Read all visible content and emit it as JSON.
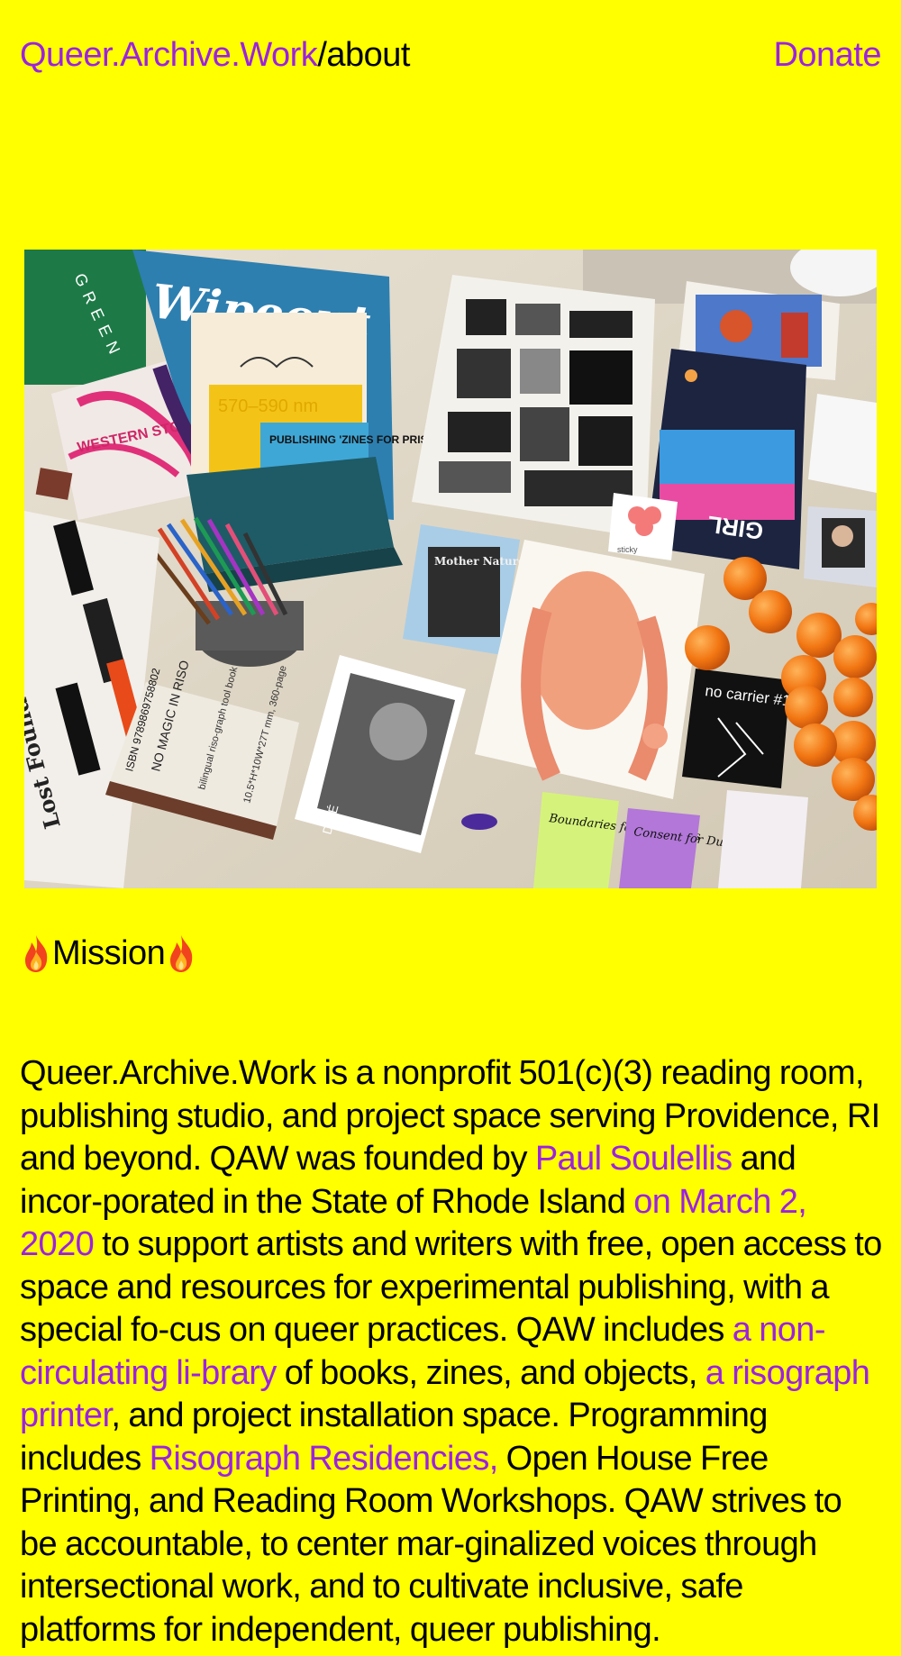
{
  "header": {
    "site_name": "Queer.Archive.Work",
    "page_path": "/about",
    "donate_label": "Donate"
  },
  "hero": {
    "alt": "Photo of a table covered in zines, risograph prints, books, pens and tangerines",
    "print_texts": {
      "green": "GREEN",
      "blue_mag": "Wipeout",
      "swatch": "570–590 nm",
      "prisoners": "PUBLISHING 'ZINES FOR PRISONERS",
      "mother": "Mother Nature's Lesbian",
      "no_carrier": "no carrier #1",
      "boundaries": "Boundaries for Beginners",
      "consent": "Consent for Dummies",
      "isbn": "ISBN 9789869758802",
      "no_magic": "NO MAGIC IN RISO",
      "bilingual": "bilingual riso-graph tool book",
      "dims": "10.5*H*10W*27T mm, 360-page",
      "dine": "DINÉ",
      "girl": "GIRL",
      "western": "WESTERN STORIES",
      "flower_caption": "sticky"
    }
  },
  "mission": {
    "heading": "Mission",
    "body": [
      {
        "text": "Queer.Archive.Work is a nonprofit 501(c)(3) reading room, publishing studio, and project space serving Providence, RI and beyond. QAW was founded by ",
        "link": false
      },
      {
        "text": "Paul Soulellis",
        "link": true
      },
      {
        "text": " and incor-porated in the State of Rhode Island ",
        "link": false
      },
      {
        "text": "on March 2, 2020",
        "link": true
      },
      {
        "text": " to support artists and writers with free, open access to space and resources for experimental publishing, with a special fo-cus on queer practices. QAW includes ",
        "link": false
      },
      {
        "text": "a non-circulating li-brary",
        "link": true
      },
      {
        "text": " of books, zines, and objects, ",
        "link": false
      },
      {
        "text": "a risograph printer",
        "link": true
      },
      {
        "text": ", and project installation space. Programming includes ",
        "link": false
      },
      {
        "text": "Risograph Residencies,",
        "link": true
      },
      {
        "text": " Open House Free Printing, and Reading Room Workshops. QAW strives to be accountable, to center mar-ginalized voices through intersectional work, and to cultivate inclusive, safe platforms for independent, queer publishing.",
        "link": false
      }
    ]
  },
  "colors": {
    "background": "#ffff00",
    "link": "#9b22e0",
    "text": "#000000"
  },
  "icons": {
    "flame": "fire-emoji-icon"
  }
}
